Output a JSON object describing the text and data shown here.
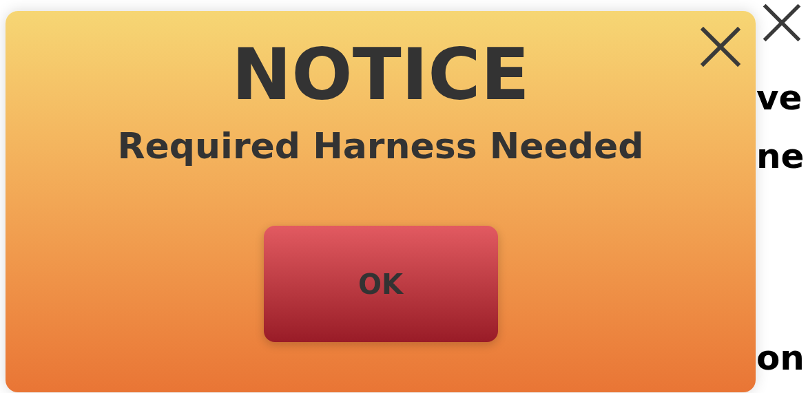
{
  "background": {
    "text_fragments": [
      "ve",
      "ne",
      "on"
    ]
  },
  "dialog": {
    "title": "NOTICE",
    "message": "Required Harness Needed",
    "button": "OK"
  }
}
